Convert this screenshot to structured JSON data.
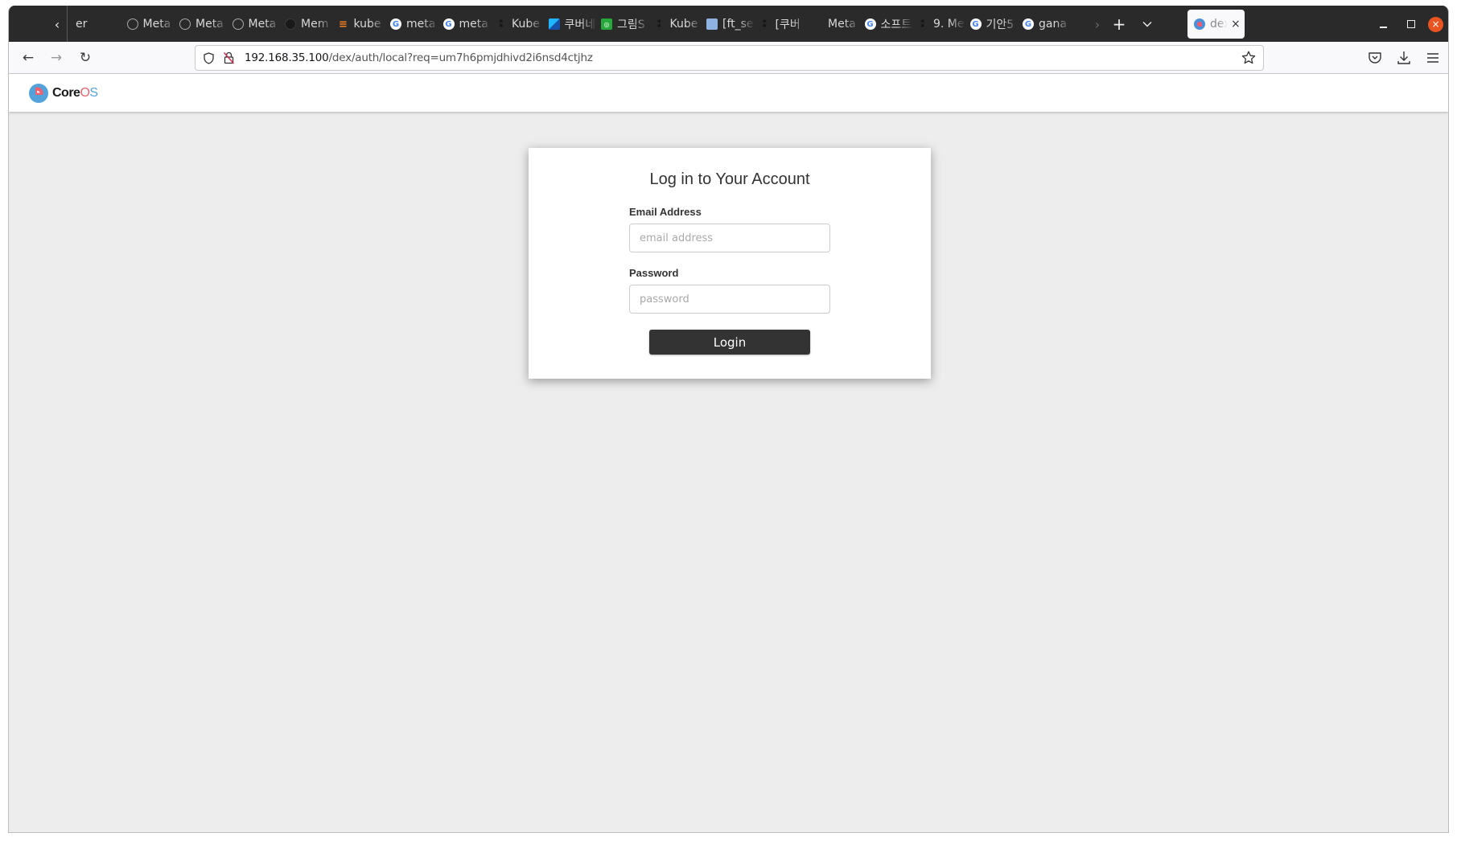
{
  "browser": {
    "tabs": [
      {
        "label": "er",
        "icon": "none"
      },
      {
        "label": "Meta",
        "icon": "meta"
      },
      {
        "label": "Meta",
        "icon": "meta"
      },
      {
        "label": "Meta",
        "icon": "meta"
      },
      {
        "label": "Mem",
        "icon": "github"
      },
      {
        "label": "kube",
        "icon": "so"
      },
      {
        "label": "meta",
        "icon": "google"
      },
      {
        "label": "meta",
        "icon": "google"
      },
      {
        "label": "Kube",
        "icon": "kube"
      },
      {
        "label": "쿠버네",
        "icon": "cube"
      },
      {
        "label": "그림S",
        "icon": "green"
      },
      {
        "label": "Kube",
        "icon": "kube"
      },
      {
        "label": "[ft_se",
        "icon": "img"
      },
      {
        "label": "[쿠버",
        "icon": "kube"
      },
      {
        "label": "Meta",
        "icon": "none"
      },
      {
        "label": "소프트",
        "icon": "google"
      },
      {
        "label": "9. Me",
        "icon": "kube"
      },
      {
        "label": "기안5",
        "icon": "google"
      },
      {
        "label": "gana",
        "icon": "google"
      }
    ],
    "active_tab": {
      "label": "dex",
      "icon": "dex",
      "close_glyph": "×"
    },
    "tab_scroll_left_glyph": "‹",
    "tab_scroll_right_glyph": "›",
    "new_tab_glyph": "+",
    "list_tabs_glyph": "⌄",
    "window_close_glyph": "×",
    "nav": {
      "back_glyph": "←",
      "forward_glyph": "→",
      "reload_glyph": "↻"
    },
    "url": {
      "host": "192.168.35.100",
      "path": "/dex/auth/local?req=um7h6pmjdhivd2i6nsd4ctjhz"
    }
  },
  "page": {
    "logo": {
      "core": "Core",
      "o": "O",
      "s": "S"
    },
    "login": {
      "title": "Log in to Your Account",
      "email_label": "Email Address",
      "email_placeholder": "email address",
      "email_value": "",
      "password_label": "Password",
      "password_placeholder": "password",
      "password_value": "",
      "button_label": "Login"
    }
  },
  "colors": {
    "accent_dark": "#333333",
    "logo_blue": "#53a3da",
    "logo_pink": "#f1616e",
    "window_close": "#e95420"
  }
}
